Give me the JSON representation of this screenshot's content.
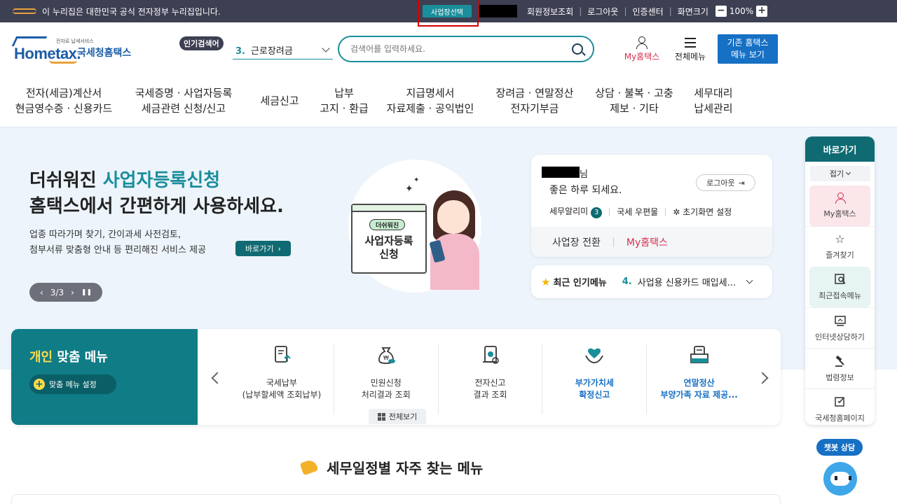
{
  "govbar": {
    "text": "이 누리집은 대한민국 공식 전자정부 누리집입니다.",
    "biz_select": "사업장선택",
    "links": [
      "회원정보조회",
      "로그아웃",
      "인증센터",
      "화면크기"
    ],
    "zoom_minus": "−",
    "zoom_value": "100%",
    "zoom_plus": "+"
  },
  "logo": {
    "small": "전자로 납세서비스",
    "mark": "Hometax.",
    "nts": "국세청홈택스"
  },
  "header": {
    "popular_badge": "인기검색어",
    "popular_rank": "3.",
    "popular_term": "근로장려금",
    "search_placeholder": "검색어를 입력하세요.",
    "my_hometax": "My홈택스",
    "all_menu": "전체메뉴",
    "old_menu_1": "기존 홈택스",
    "old_menu_2": "메뉴 보기"
  },
  "gnb": [
    "전자(세금)계산서\n현금영수증 · 신용카드",
    "국세증명 · 사업자등록\n세금관련 신청/신고",
    "세금신고",
    "납부\n고지 · 환급",
    "지급명세서\n자료제출 · 공익법인",
    "장려금 · 연말정산\n전자기부금",
    "상담 · 불복 · 고충\n제보 · 기타",
    "세무대리\n납세관리"
  ],
  "hero": {
    "title_a": "더쉬워진 ",
    "title_hl": "사업자등록신청",
    "title_2": "홈택스에서 간편하게 사용하세요.",
    "desc_1": "업종 따라가며 찾기, 간이과세 사전검토,",
    "desc_2": "첨부서류 맞춤형 안내 등 편리해진 서비스 제공",
    "go": "바로가기",
    "go_arrow": "›",
    "pager_prev": "‹",
    "pager_text": "3/3",
    "pager_next": "›",
    "pager_pause": "❚❚",
    "card_tag": "더쉬워진",
    "card_big_1": "사업자등록",
    "card_big_2": "신청"
  },
  "login": {
    "suffix": "님",
    "greeting": "좋은 하루 되세요.",
    "logout": "로그아웃",
    "logout_icon": "⇥",
    "alarm_label": "세무알리미",
    "alarm_count": "3",
    "mailbox": "국세 우편물",
    "settings_icon": "✲",
    "settings": "초기화면 설정",
    "switch_biz": "사업장 전환",
    "my_hometax": "My홈택스"
  },
  "popular_menu": {
    "star": "★",
    "label": "최근 인기메뉴",
    "rank": "4.",
    "text": "사업용 신용카드 매입세..."
  },
  "custom": {
    "title_y": "개인",
    "title_rest": " 맞춤 메뉴",
    "setting_plus": "+",
    "setting": "맞춤 메뉴 설정",
    "items": [
      {
        "label": "국세납부\n(납부할세액 조회납부)",
        "strong": false,
        "icon": "document-upload-icon"
      },
      {
        "label": "민원신청\n처리결과 조회",
        "strong": false,
        "icon": "money-bag-icon"
      },
      {
        "label": "전자신고\n결과 조회",
        "strong": false,
        "icon": "scroll-bell-icon"
      },
      {
        "label": "부가가치세\n확정신고",
        "strong": true,
        "icon": "heart-hands-icon"
      },
      {
        "label": "연말정산\n부양가족 자료 제공...",
        "strong": true,
        "icon": "folder-document-icon"
      }
    ],
    "view_all": "전체보기"
  },
  "schedule": {
    "title": "세무일정별 자주 찾는 메뉴"
  },
  "quick": {
    "header": "바로가기",
    "fold": "접기",
    "items": [
      "My홈택스",
      "즐겨찾기",
      "최근접속메뉴",
      "인터넷상담하기",
      "법령정보",
      "국세청홈페이지"
    ],
    "star": "☆"
  },
  "chatbot": {
    "label": "챗봇 상담"
  },
  "colors": {
    "teal": "#1a8e9b",
    "dark_teal": "#0f6a72",
    "brand_blue": "#1670c4",
    "accent_red": "#d6304f",
    "gov_bar": "#3d3f52"
  }
}
